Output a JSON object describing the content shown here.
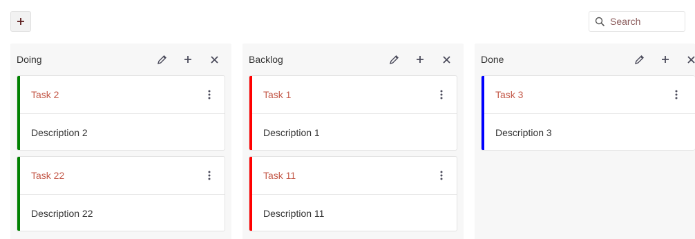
{
  "toolbar": {
    "add_icon": "plus-icon"
  },
  "search": {
    "placeholder": "Search",
    "icon": "search-icon"
  },
  "columns": [
    {
      "title": "Doing",
      "cards": [
        {
          "title": "Task 2",
          "description": "Description 2",
          "color": "#008000"
        },
        {
          "title": "Task 22",
          "description": "Description 22",
          "color": "#008000"
        }
      ]
    },
    {
      "title": "Backlog",
      "cards": [
        {
          "title": "Task 1",
          "description": "Description 1",
          "color": "#ff0000"
        },
        {
          "title": "Task 11",
          "description": "Description 11",
          "color": "#ff0000"
        }
      ]
    },
    {
      "title": "Done",
      "cards": [
        {
          "title": "Task 3",
          "description": "Description 3",
          "color": "#0000ff"
        }
      ]
    }
  ],
  "colors": {
    "task_title": "#c45a4a",
    "column_bg": "#f7f7f7",
    "icon": "#4a4a5a"
  }
}
